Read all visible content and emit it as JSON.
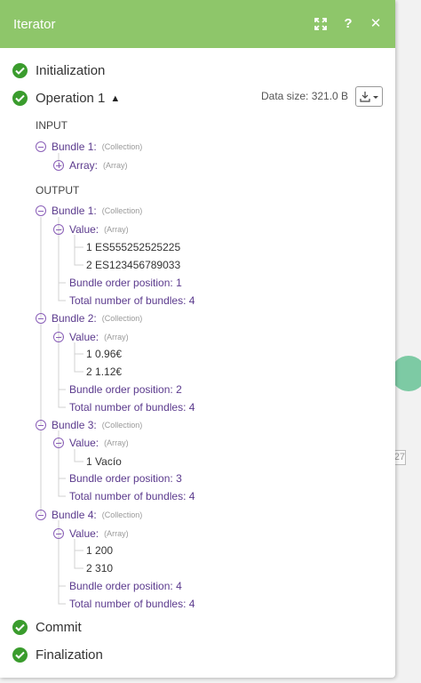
{
  "header": {
    "title": "Iterator"
  },
  "stages": {
    "initialization": "Initialization",
    "operation": "Operation 1",
    "commit": "Commit",
    "finalization": "Finalization"
  },
  "data_size": "Data size: 321.0 B",
  "input": {
    "label": "INPUT",
    "bundle1": {
      "key": "Bundle 1:",
      "type": "(Collection)"
    },
    "array": {
      "key": "Array:",
      "type": "(Array)"
    }
  },
  "output": {
    "label": "OUTPUT",
    "bundles": [
      {
        "key": "Bundle 1:",
        "type": "(Collection)",
        "value_key": "Value:",
        "value_type": "(Array)",
        "items": [
          {
            "idx": "1",
            "val": "ES555252525225"
          },
          {
            "idx": "2",
            "val": "ES123456789033"
          }
        ],
        "order": "Bundle order position: 1",
        "total": "Total number of bundles: 4"
      },
      {
        "key": "Bundle 2:",
        "type": "(Collection)",
        "value_key": "Value:",
        "value_type": "(Array)",
        "items": [
          {
            "idx": "1",
            "val": "0.96€"
          },
          {
            "idx": "2",
            "val": "1.12€"
          }
        ],
        "order": "Bundle order position: 2",
        "total": "Total number of bundles: 4"
      },
      {
        "key": "Bundle 3:",
        "type": "(Collection)",
        "value_key": "Value:",
        "value_type": "(Array)",
        "items": [
          {
            "idx": "1",
            "val": "Vacío"
          }
        ],
        "order": "Bundle order position: 3",
        "total": "Total number of bundles: 4"
      },
      {
        "key": "Bundle 4:",
        "type": "(Collection)",
        "value_key": "Value:",
        "value_type": "(Array)",
        "items": [
          {
            "idx": "1",
            "val": "200"
          },
          {
            "idx": "2",
            "val": "310"
          }
        ],
        "order": "Bundle order position: 4",
        "total": "Total number of bundles: 4"
      }
    ]
  },
  "background": {
    "box_text": "27"
  },
  "colors": {
    "header": "#8ec66a",
    "check": "#3a9c2d",
    "key": "#5b3a8d",
    "toggle": "#8a5fb8"
  }
}
